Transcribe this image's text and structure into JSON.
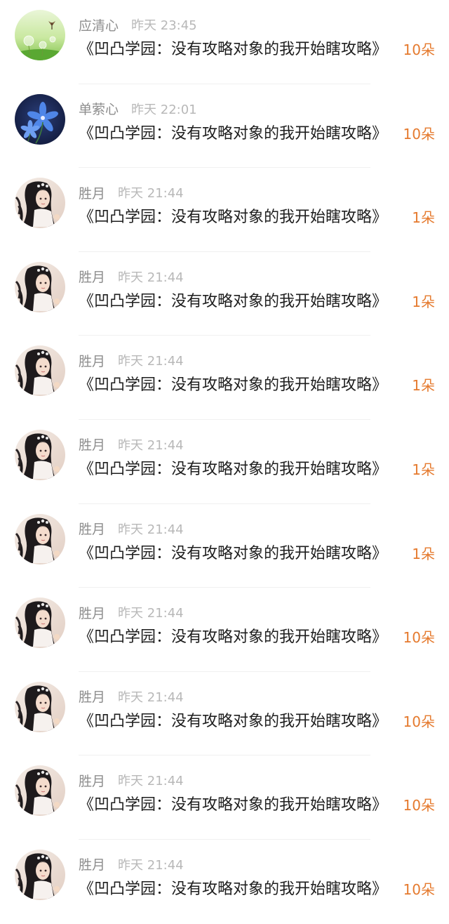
{
  "colors": {
    "name": "#8e8e8e",
    "time": "#b8b8b8",
    "message": "#1e1e1e",
    "count": "#e57a2e",
    "divider": "#f0f0f0"
  },
  "items": [
    {
      "name": "应清心",
      "time": "昨天 23:45",
      "message": "《凹凸学园：没有攻略对象的我开始瞎攻略》",
      "count": "10朵",
      "avatar": "dandelion-avatar"
    },
    {
      "name": "单萦心",
      "time": "昨天 22:01",
      "message": "《凹凸学园：没有攻略对象的我开始瞎攻略》",
      "count": "10朵",
      "avatar": "blue-flower-avatar"
    },
    {
      "name": "胜月",
      "time": "昨天 21:44",
      "message": "《凹凸学园：没有攻略对象的我开始瞎攻略》",
      "count": "1朵",
      "avatar": "anime-girl-avatar"
    },
    {
      "name": "胜月",
      "time": "昨天 21:44",
      "message": "《凹凸学园：没有攻略对象的我开始瞎攻略》",
      "count": "1朵",
      "avatar": "anime-girl-avatar"
    },
    {
      "name": "胜月",
      "time": "昨天 21:44",
      "message": "《凹凸学园：没有攻略对象的我开始瞎攻略》",
      "count": "1朵",
      "avatar": "anime-girl-avatar"
    },
    {
      "name": "胜月",
      "time": "昨天 21:44",
      "message": "《凹凸学园：没有攻略对象的我开始瞎攻略》",
      "count": "1朵",
      "avatar": "anime-girl-avatar"
    },
    {
      "name": "胜月",
      "time": "昨天 21:44",
      "message": "《凹凸学园：没有攻略对象的我开始瞎攻略》",
      "count": "1朵",
      "avatar": "anime-girl-avatar"
    },
    {
      "name": "胜月",
      "time": "昨天 21:44",
      "message": "《凹凸学园：没有攻略对象的我开始瞎攻略》",
      "count": "10朵",
      "avatar": "anime-girl-avatar"
    },
    {
      "name": "胜月",
      "time": "昨天 21:44",
      "message": "《凹凸学园：没有攻略对象的我开始瞎攻略》",
      "count": "10朵",
      "avatar": "anime-girl-avatar"
    },
    {
      "name": "胜月",
      "time": "昨天 21:44",
      "message": "《凹凸学园：没有攻略对象的我开始瞎攻略》",
      "count": "10朵",
      "avatar": "anime-girl-avatar"
    },
    {
      "name": "胜月",
      "time": "昨天 21:44",
      "message": "《凹凸学园：没有攻略对象的我开始瞎攻略》",
      "count": "10朵",
      "avatar": "anime-girl-avatar"
    }
  ]
}
